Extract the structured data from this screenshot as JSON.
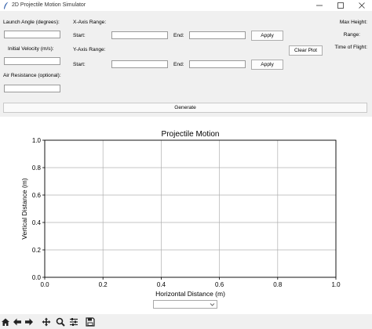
{
  "window": {
    "title": "2D Projectile Motion Simulator"
  },
  "inputs": {
    "launch_angle_label": "Launch Angle (degrees):",
    "launch_angle_value": "",
    "initial_velocity_label": "Initial Velocity (m/s):",
    "initial_velocity_value": "",
    "air_resistance_label": "Air Resistance (optional):",
    "air_resistance_value": ""
  },
  "x_range": {
    "heading": "X-Axis Range:",
    "start_label": "Start:",
    "start_value": "",
    "end_label": "End:",
    "end_value": "",
    "apply_label": "Apply"
  },
  "y_range": {
    "heading": "Y-Axis Range:",
    "start_label": "Start:",
    "start_value": "",
    "end_label": "End:",
    "end_value": "",
    "apply_label": "Apply"
  },
  "clear_plot_label": "Clear Plot",
  "results": {
    "max_height_label": "Max Height:",
    "range_label": "Range:",
    "time_of_flight_label": "Time of Flight:"
  },
  "generate_label": "Generate",
  "combo": {
    "selected": ""
  },
  "chart_data": {
    "type": "line",
    "title": "Projectile Motion",
    "xlabel": "Horizontal Distance (m)",
    "ylabel": "Vertical Distance (m)",
    "xlim": [
      0.0,
      1.0
    ],
    "ylim": [
      0.0,
      1.0
    ],
    "x_ticks": [
      "0.0",
      "0.2",
      "0.4",
      "0.6",
      "0.8",
      "1.0"
    ],
    "y_ticks": [
      "0.0",
      "0.2",
      "0.4",
      "0.6",
      "0.8",
      "1.0"
    ],
    "grid": true,
    "series": []
  },
  "toolbar": [
    "home-icon",
    "back-icon",
    "forward-icon",
    "pan-icon",
    "zoom-icon",
    "configure-icon",
    "save-icon"
  ],
  "colors": {
    "window_bg": "#f0f0f0",
    "plot_bg": "#ffffff",
    "axis": "#000000",
    "grid": "#b0b0b0"
  }
}
